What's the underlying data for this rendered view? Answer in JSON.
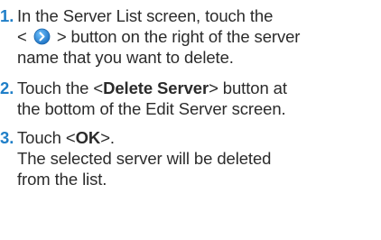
{
  "steps": [
    {
      "number": "1.",
      "line1": "In the Server List screen, touch the",
      "line2_before": "<",
      "line2_after": "> button on the right of the server",
      "line3": "name that you want to delete.",
      "icon": "chevron-right-circle-icon"
    },
    {
      "number": "2.",
      "line1_before": "Touch the <",
      "line1_bold": "Delete Server",
      "line1_after": "> button at",
      "line2": "the bottom of the Edit Server screen."
    },
    {
      "number": "3.",
      "line1_before": "Touch <",
      "line1_bold": "OK",
      "line1_after": ">.",
      "line2": "The selected server will be deleted",
      "line3": "from the list."
    }
  ],
  "colors": {
    "step_number": "#1f7fc8",
    "text": "#2b2b2b",
    "icon_fill": "#2f8fd8"
  }
}
